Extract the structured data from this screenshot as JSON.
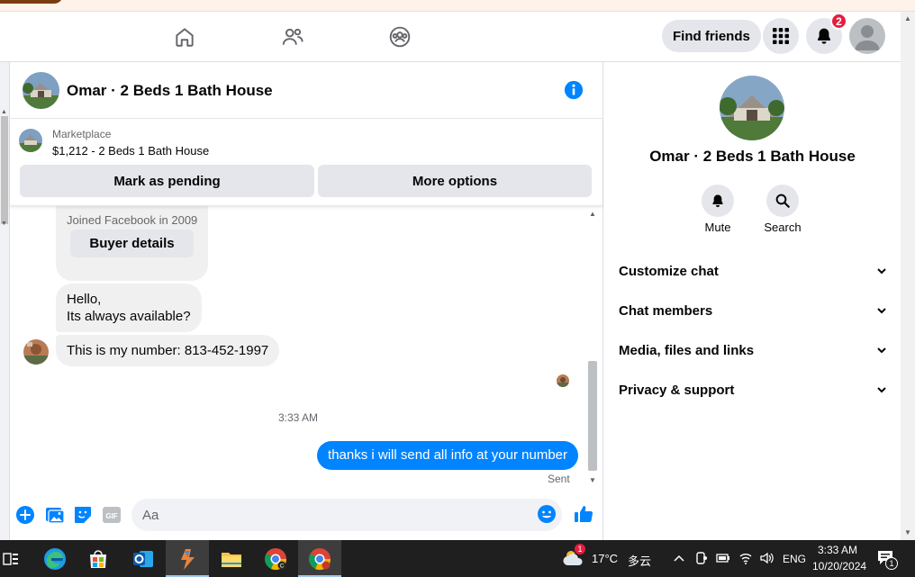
{
  "nav": {
    "find_friends": "Find friends",
    "notif_count": "2"
  },
  "chat": {
    "title": "Omar · 2 Beds 1 Bath House",
    "marketplace_label": "Marketplace",
    "listing": "$1,212 - 2 Beds 1 Bath House",
    "mark_pending": "Mark as pending",
    "more_options": "More options"
  },
  "messages": {
    "joined": "Joined Facebook in 2009",
    "buyer_details": "Buyer details",
    "msg1_line1": "Hello,",
    "msg1_line2": "Its always available?",
    "msg2": "This is my number: 813-452-1997",
    "time": "3:33 AM",
    "outgoing": "thanks i will send all info at your number",
    "status": "Sent"
  },
  "composer": {
    "placeholder": "Aa"
  },
  "info": {
    "name": "Omar · 2 Beds 1 Bath House",
    "mute": "Mute",
    "search": "Search",
    "sections": [
      "Customize chat",
      "Chat members",
      "Media, files and links",
      "Privacy & support"
    ]
  },
  "taskbar": {
    "temperature": "17°C",
    "weather": "多云",
    "weather_badge": "1",
    "language": "ENG",
    "time": "3:33 AM",
    "date": "10/20/2024",
    "notif_count": "1"
  },
  "colors": {
    "accent": "#0084ff",
    "badge": "#e41e3f"
  }
}
